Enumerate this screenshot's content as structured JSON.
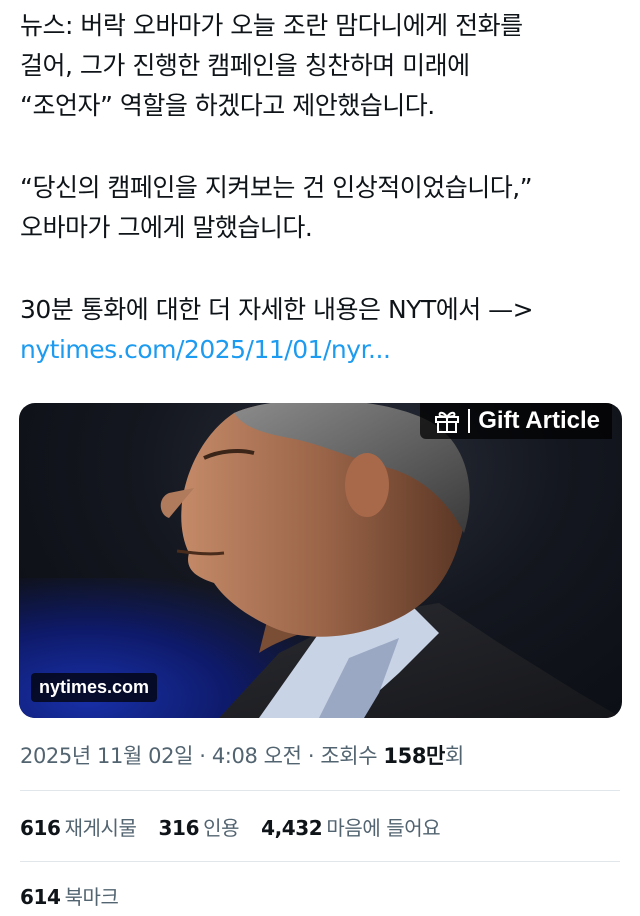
{
  "tweet": {
    "lines": [
      "뉴스: 버락 오바마가 오늘 조란 맘다니에게 전화를",
      "걸어, 그가 진행한 캠페인을 칭찬하며 미래에",
      "“조언자” 역할을 하겠다고 제안했습니다.",
      "“당신의 캠페인을 지켜보는 건 인상적이었습니다,”",
      "오바마가 그에게 말했습니다.",
      "30분 통화에 대한 더 자세한 내용은 NYT에서 —>"
    ],
    "link": "nytimes.com/2025/11/01/nyr..."
  },
  "card": {
    "gift_label": "Gift Article",
    "source": "nytimes.com"
  },
  "meta": {
    "date": "2025년 11월 02일",
    "time": "4:08 오전",
    "views_label": "조회수",
    "views_value": "158만",
    "views_suffix": "회"
  },
  "stats": {
    "reposts_count": "616",
    "reposts_label": "재게시물",
    "quotes_count": "316",
    "quotes_label": "인용",
    "likes_count": "4,432",
    "likes_label": "마음에 들어요",
    "bookmarks_count": "614",
    "bookmarks_label": "북마크"
  },
  "colors": {
    "link": "#1d9bf0",
    "secondary_text": "#536471",
    "primary_text": "#0f1419"
  },
  "icons": [
    "gift-icon"
  ]
}
